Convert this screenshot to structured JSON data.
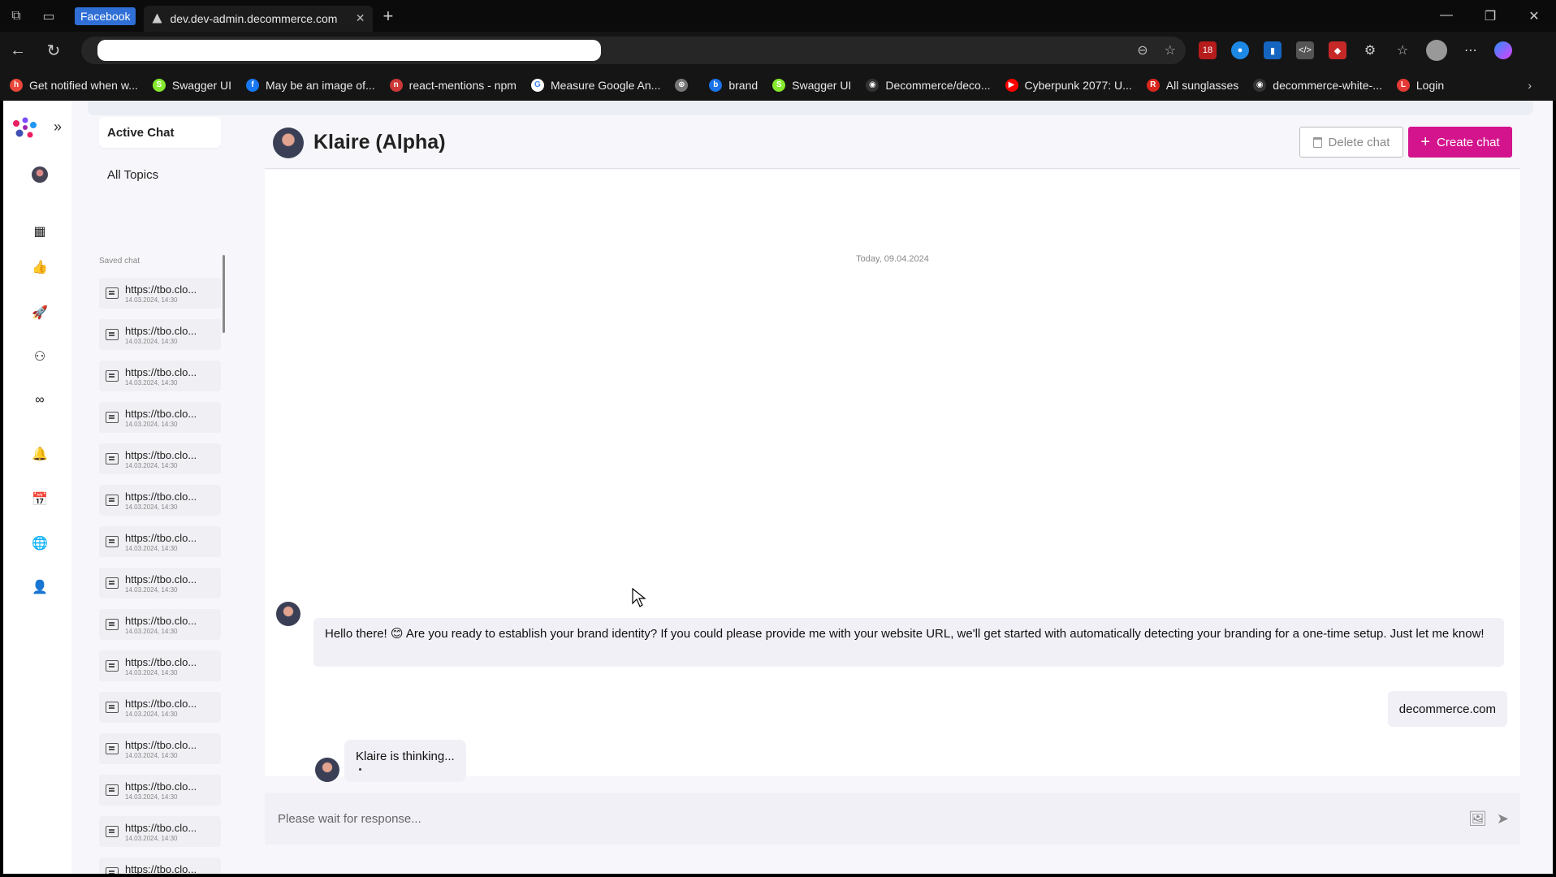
{
  "browser": {
    "tab_group": "Facebook",
    "tab_title": "dev.dev-admin.decommerce.com",
    "window_controls": [
      "—",
      "❐",
      "✕"
    ],
    "extension_badge": "18"
  },
  "bookmarks": [
    {
      "label": "Get notified when w...",
      "color": "#e8463a",
      "glyph": "h"
    },
    {
      "label": "Swagger UI",
      "color": "#85ea2d",
      "glyph": "S"
    },
    {
      "label": "May be an image of...",
      "color": "#1877f2",
      "glyph": "f"
    },
    {
      "label": "react-mentions - npm",
      "color": "#cb3837",
      "glyph": "n"
    },
    {
      "label": "Measure Google An...",
      "color": "#ffffff",
      "glyph": "G"
    },
    {
      "label": "",
      "color": "#777777",
      "glyph": "⊕"
    },
    {
      "label": "brand",
      "color": "#1a73e8",
      "glyph": "b"
    },
    {
      "label": "Swagger UI",
      "color": "#85ea2d",
      "glyph": "S"
    },
    {
      "label": "Decommerce/deco...",
      "color": "#333333",
      "glyph": "◉"
    },
    {
      "label": "Cyberpunk 2077: U...",
      "color": "#ff0000",
      "glyph": "▶"
    },
    {
      "label": "All sunglasses",
      "color": "#d9261c",
      "glyph": "R"
    },
    {
      "label": "decommerce-white-...",
      "color": "#333333",
      "glyph": "◉"
    },
    {
      "label": "Login",
      "color": "#e53935",
      "glyph": "L"
    }
  ],
  "sidebar": {
    "active_chat": "Active Chat",
    "all_topics": "All Topics",
    "saved_label": "Saved chat",
    "saved_items": [
      {
        "title": "https://tbo.clo...",
        "date": "14.03.2024, 14:30"
      },
      {
        "title": "https://tbo.clo...",
        "date": "14.03.2024, 14:30"
      },
      {
        "title": "https://tbo.clo...",
        "date": "14.03.2024, 14:30"
      },
      {
        "title": "https://tbo.clo...",
        "date": "14.03.2024, 14:30"
      },
      {
        "title": "https://tbo.clo...",
        "date": "14.03.2024, 14:30"
      },
      {
        "title": "https://tbo.clo...",
        "date": "14.03.2024, 14:30"
      },
      {
        "title": "https://tbo.clo...",
        "date": "14.03.2024, 14:30"
      },
      {
        "title": "https://tbo.clo...",
        "date": "14.03.2024, 14:30"
      },
      {
        "title": "https://tbo.clo...",
        "date": "14.03.2024, 14:30"
      },
      {
        "title": "https://tbo.clo...",
        "date": "14.03.2024, 14:30"
      },
      {
        "title": "https://tbo.clo...",
        "date": "14.03.2024, 14:30"
      },
      {
        "title": "https://tbo.clo...",
        "date": "14.03.2024, 14:30"
      },
      {
        "title": "https://tbo.clo...",
        "date": "14.03.2024, 14:30"
      },
      {
        "title": "https://tbo.clo...",
        "date": "14.03.2024, 14:30"
      },
      {
        "title": "https://tbo.clo...",
        "date": "14.03.2024, 14:30"
      }
    ]
  },
  "chat": {
    "title": "Klaire (Alpha)",
    "delete_label": "Delete chat",
    "create_label": "Create chat",
    "date_separator": "Today, 09.04.2024",
    "bot_message": "Hello there! 😊 Are you ready to establish your brand identity? If you could please provide me with your website URL, we'll get started with automatically detecting your branding for a one-time setup. Just let me know!",
    "user_message": "decommerce.com",
    "thinking": "Klaire is thinking...",
    "composer_placeholder": "Please wait for response..."
  },
  "colors": {
    "accent": "#d4148d"
  }
}
